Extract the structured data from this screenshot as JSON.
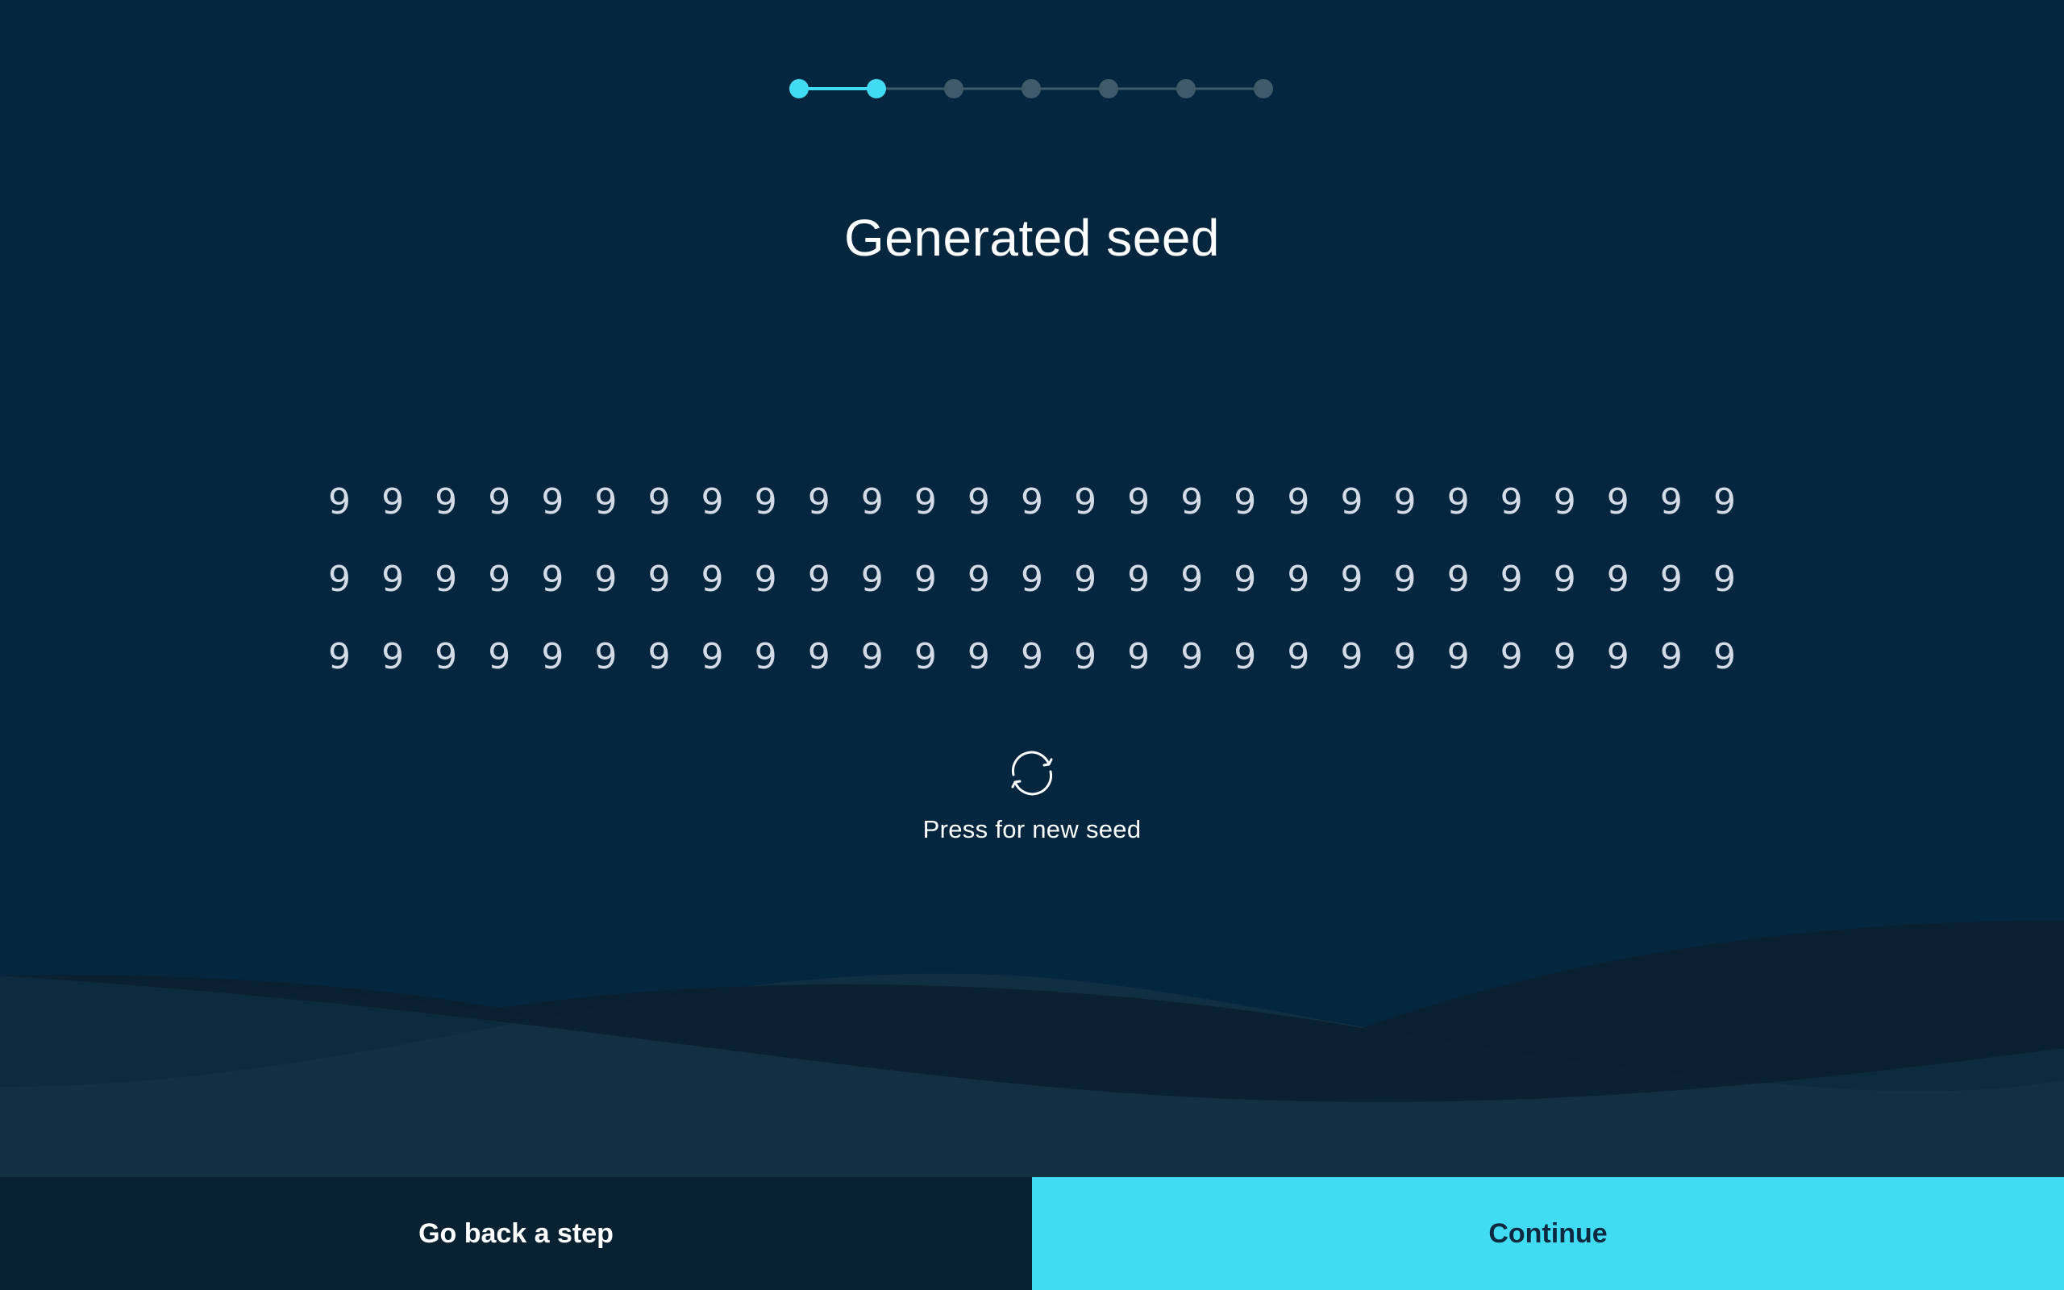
{
  "stepper": {
    "total_steps": 7,
    "current_step": 2,
    "colors": {
      "active": "#41dcf3",
      "inactive": "#3f5b6b"
    }
  },
  "title": "Generated seed",
  "seed": {
    "rows": [
      "999999999999999999999999999",
      "999999999999999999999999999",
      "999999999999999999999999999"
    ]
  },
  "refresh": {
    "icon": "refresh-icon",
    "label": "Press for new seed"
  },
  "footer": {
    "back_label": "Go back a step",
    "continue_label": "Continue"
  },
  "colors": {
    "background": "#04273f",
    "accent": "#41dcf3",
    "back_button": "#092232",
    "text_on_accent": "#0b2a3f"
  }
}
